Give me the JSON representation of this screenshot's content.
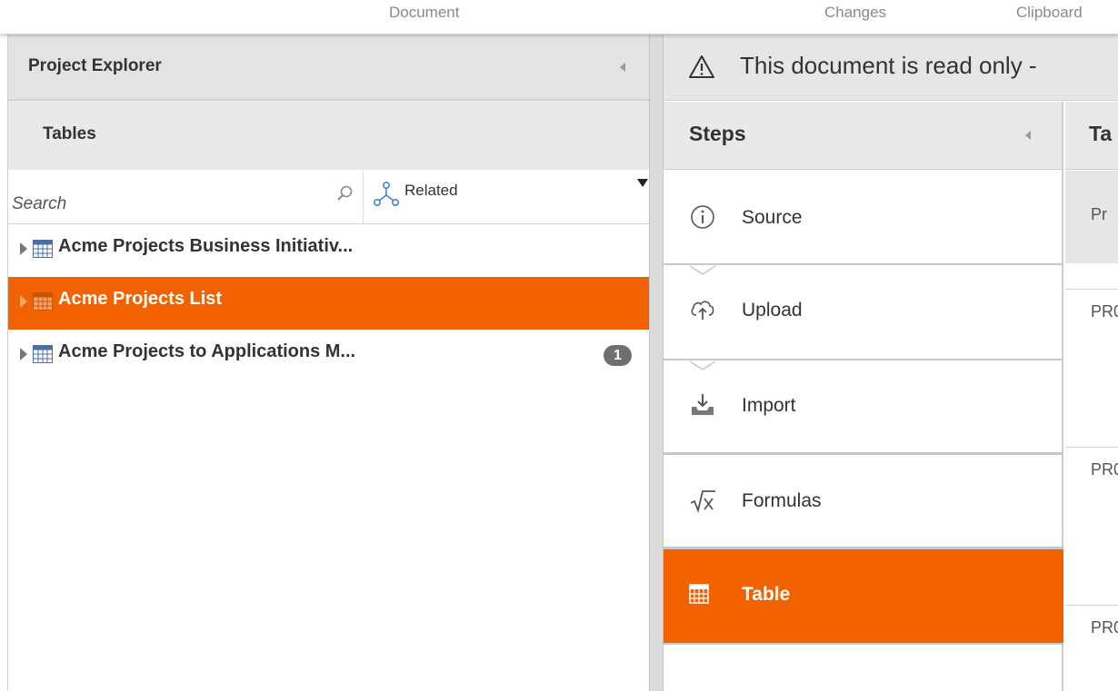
{
  "ribbon": {
    "groups": [
      "Document",
      "Changes",
      "Clipboard"
    ]
  },
  "project_explorer": {
    "title": "Project Explorer",
    "tables_header": "Tables",
    "search": {
      "placeholder": "Search",
      "value": ""
    },
    "related_label": "Related",
    "items": [
      {
        "label": "Acme Projects Business Initiativ...",
        "selected": false,
        "badge": ""
      },
      {
        "label": "Acme Projects List",
        "selected": true,
        "badge": ""
      },
      {
        "label": "Acme Projects to Applications M...",
        "selected": false,
        "badge": "1"
      }
    ]
  },
  "read_only_banner": {
    "text": "This document is read only -"
  },
  "steps": {
    "title": "Steps",
    "items": [
      {
        "label": "Source",
        "icon": "info-icon",
        "active": false
      },
      {
        "label": "Upload",
        "icon": "cloud-upload-icon",
        "active": false
      },
      {
        "label": "Import",
        "icon": "import-tray-icon",
        "active": false
      },
      {
        "label": "Formulas",
        "icon": "formula-sqrt-icon",
        "active": false
      },
      {
        "label": "Table",
        "icon": "table-grid-icon",
        "active": true
      }
    ]
  },
  "table_tab": {
    "title": "Ta",
    "column_header": "Pr",
    "cells": [
      "PR0",
      "PR0",
      "PR0"
    ]
  },
  "colors": {
    "accent": "#f26300",
    "header_bg": "#e3e3e3",
    "badge": "#6f6f6f"
  }
}
